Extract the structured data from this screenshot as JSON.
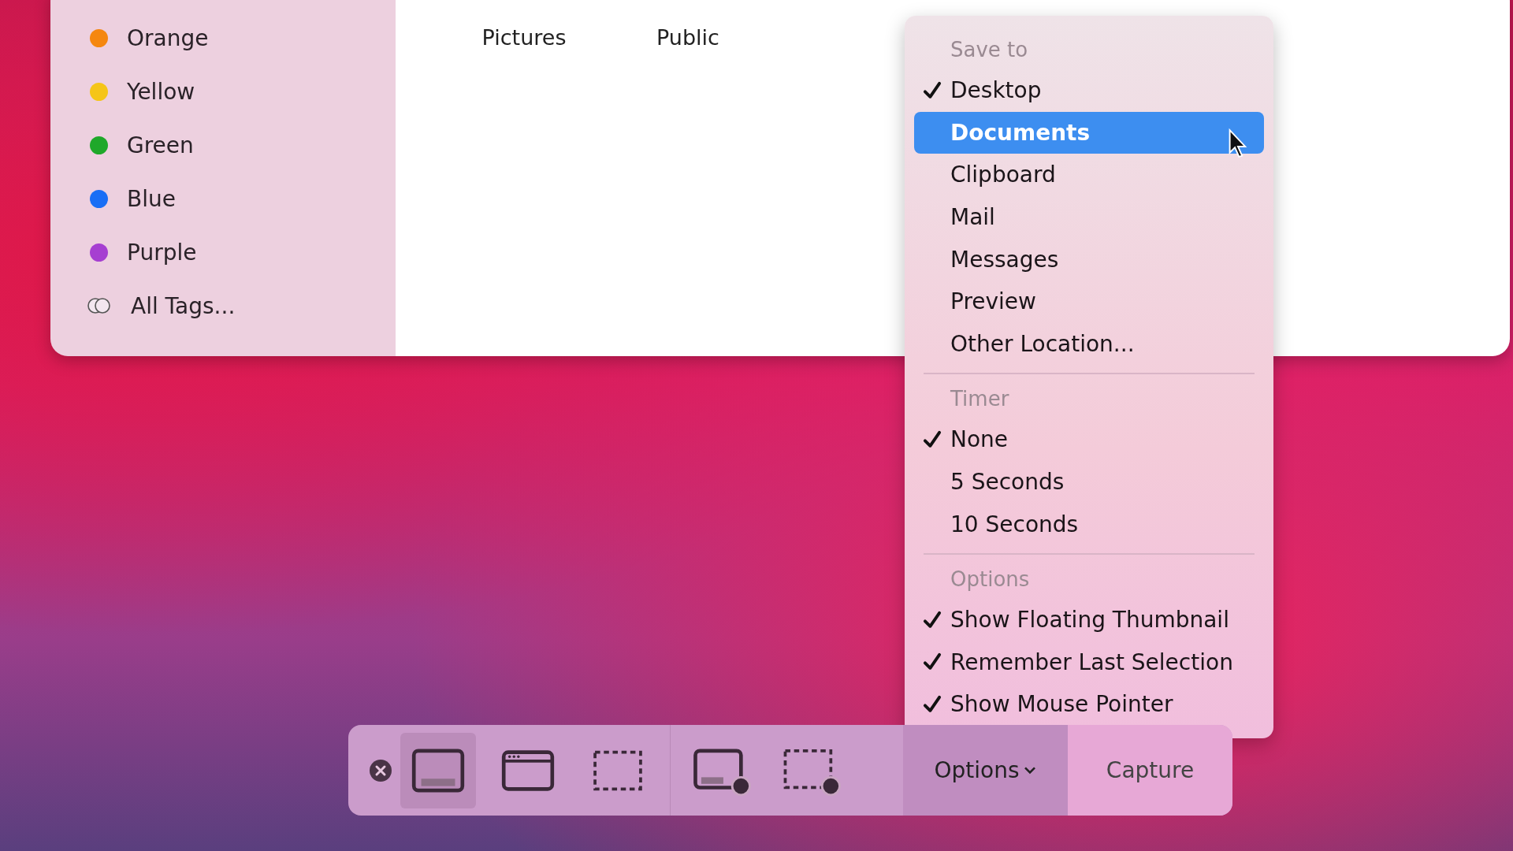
{
  "sidebar": {
    "tags": [
      {
        "label": "Orange",
        "color": "#f5870f"
      },
      {
        "label": "Yellow",
        "color": "#f5c518"
      },
      {
        "label": "Green",
        "color": "#1fa82a"
      },
      {
        "label": "Blue",
        "color": "#1a6ef5"
      },
      {
        "label": "Purple",
        "color": "#a63fd1"
      }
    ],
    "all_tags": "All Tags..."
  },
  "folders": [
    "Pictures",
    "Public"
  ],
  "menu": {
    "sections": [
      {
        "heading": "Save to",
        "items": [
          {
            "label": "Desktop",
            "checked": true,
            "selected": false
          },
          {
            "label": "Documents",
            "checked": false,
            "selected": true
          },
          {
            "label": "Clipboard",
            "checked": false,
            "selected": false
          },
          {
            "label": "Mail",
            "checked": false,
            "selected": false
          },
          {
            "label": "Messages",
            "checked": false,
            "selected": false
          },
          {
            "label": "Preview",
            "checked": false,
            "selected": false
          },
          {
            "label": "Other Location...",
            "checked": false,
            "selected": false
          }
        ]
      },
      {
        "heading": "Timer",
        "items": [
          {
            "label": "None",
            "checked": true,
            "selected": false
          },
          {
            "label": "5 Seconds",
            "checked": false,
            "selected": false
          },
          {
            "label": "10 Seconds",
            "checked": false,
            "selected": false
          }
        ]
      },
      {
        "heading": "Options",
        "items": [
          {
            "label": "Show Floating Thumbnail",
            "checked": true,
            "selected": false
          },
          {
            "label": "Remember Last Selection",
            "checked": true,
            "selected": false
          },
          {
            "label": "Show Mouse Pointer",
            "checked": true,
            "selected": false
          }
        ]
      }
    ]
  },
  "toolbar": {
    "tools": [
      {
        "kind": "entire-screen",
        "selected": true
      },
      {
        "kind": "window",
        "selected": false
      },
      {
        "kind": "selection",
        "selected": false
      },
      {
        "kind": "record-screen",
        "selected": false
      },
      {
        "kind": "record-selection",
        "selected": false
      }
    ],
    "options": "Options",
    "capture": "Capture"
  }
}
